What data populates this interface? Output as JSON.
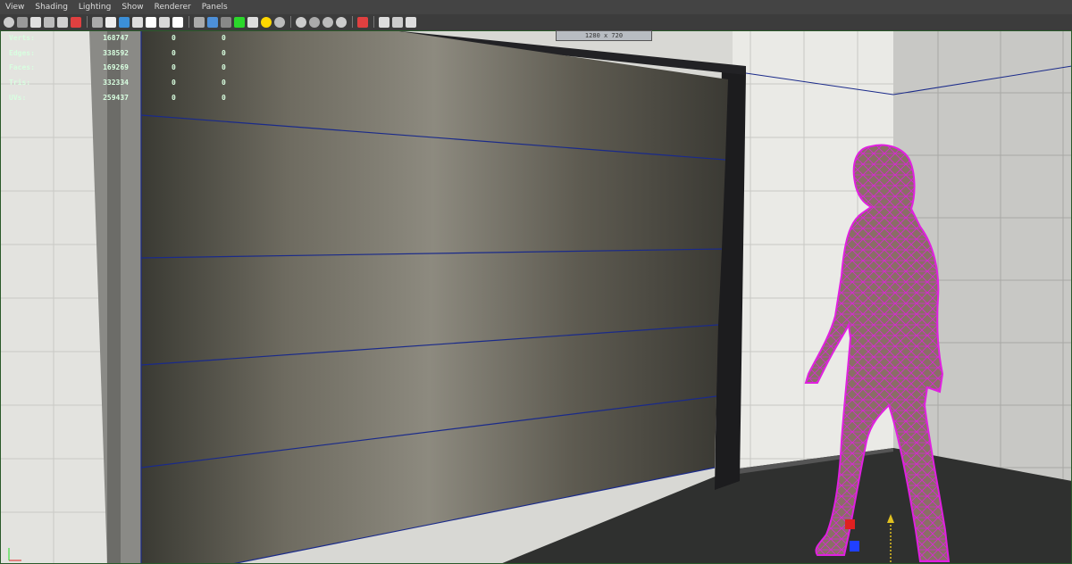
{
  "menu": {
    "items": [
      "View",
      "Shading",
      "Lighting",
      "Show",
      "Renderer",
      "Panels"
    ]
  },
  "toolbar": {
    "icons": [
      "camera-attributes-icon",
      "bookmark-icon",
      "image-plane-icon",
      "grid-icon",
      "film-gate-icon",
      "resolution-gate-icon",
      "gate-mask-icon",
      "field-chart-icon",
      "safe-action-icon",
      "safe-title-icon",
      "wireframe-icon",
      "smooth-shade-icon",
      "wireframe-on-shaded-icon",
      "textured-icon",
      "use-all-lights-icon",
      "shadows-icon",
      "isolate-select-icon",
      "xray-icon",
      "xray-joints-icon",
      "xray-components-icon",
      "camera-select-icon",
      "single-view-icon",
      "four-view-icon",
      "outliner-view-icon"
    ]
  },
  "hud": {
    "rows": [
      {
        "label": "Verts:",
        "value": "168747",
        "a": "0",
        "b": "0"
      },
      {
        "label": "Edges:",
        "value": "338592",
        "a": "0",
        "b": "0"
      },
      {
        "label": "Faces:",
        "value": "169269",
        "a": "0",
        "b": "0"
      },
      {
        "label": "Tris:",
        "value": "332334",
        "a": "0",
        "b": "0"
      },
      {
        "label": "UVs:",
        "value": "259437",
        "a": "0",
        "b": "0"
      }
    ],
    "resolution": "1280 x 720"
  },
  "colors": {
    "hud_text": "#d8ffe0",
    "selection_wire": "#e020e0",
    "frame_line": "#1a2a8a",
    "accent_red": "#e02020",
    "accent_blue": "#2040ff"
  }
}
